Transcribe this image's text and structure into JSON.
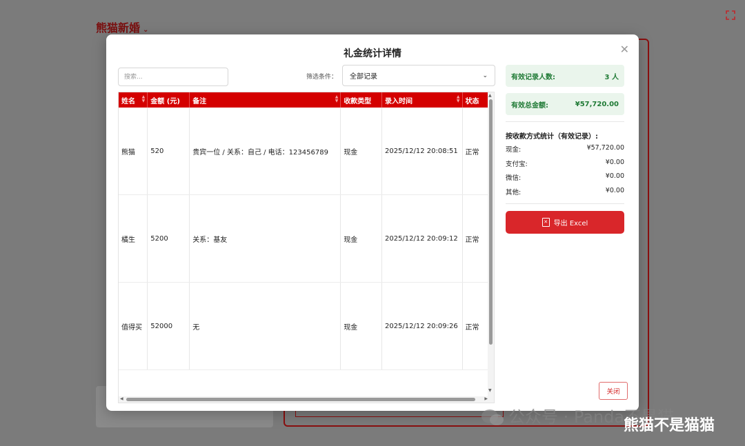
{
  "background": {
    "app_title": "熊猫新婚"
  },
  "modal": {
    "title": "礼金统计详情",
    "close_icon": "close-icon",
    "search": {
      "placeholder": "搜索..."
    },
    "filter": {
      "label": "筛选条件：",
      "selected": "全部记录"
    },
    "table": {
      "headers": [
        "姓名",
        "金额 (元)",
        "备注",
        "收款类型",
        "录入时间",
        "状态"
      ],
      "rows": [
        [
          "熊猫",
          "520",
          "贵宾一位 / 关系：自己 / 电话：123456789",
          "现金",
          "2025/12/12 20:08:51",
          "正常"
        ],
        [
          "橘生",
          "5200",
          "关系：基友",
          "现金",
          "2025/12/12 20:09:12",
          "正常"
        ],
        [
          "值得买",
          "52000",
          "无",
          "现金",
          "2025/12/12 20:09:26",
          "正常"
        ]
      ]
    },
    "stats": {
      "valid_count_label": "有效记录人数:",
      "valid_count_value": "3 人",
      "valid_total_label": "有效总金额:",
      "valid_total_value": "¥57,720.00",
      "breakdown_title": "按收款方式统计（有效记录）:",
      "breakdown": [
        {
          "label": "现金:",
          "value": "¥57,720.00"
        },
        {
          "label": "支付宝:",
          "value": "¥0.00"
        },
        {
          "label": "微信:",
          "value": "¥0.00"
        },
        {
          "label": "其他:",
          "value": "¥0.00"
        }
      ]
    },
    "export_label": "导出 Excel",
    "close_label": "关闭"
  },
  "watermark": {
    "text": "公众号 · Panda不是猫",
    "overlay": "熊猫不是猫猫"
  },
  "colors": {
    "primary": "#d40000",
    "overlay": "#7b7b7b",
    "stat_bg": "#eaf5ec",
    "stat_text": "#1f7a35"
  }
}
